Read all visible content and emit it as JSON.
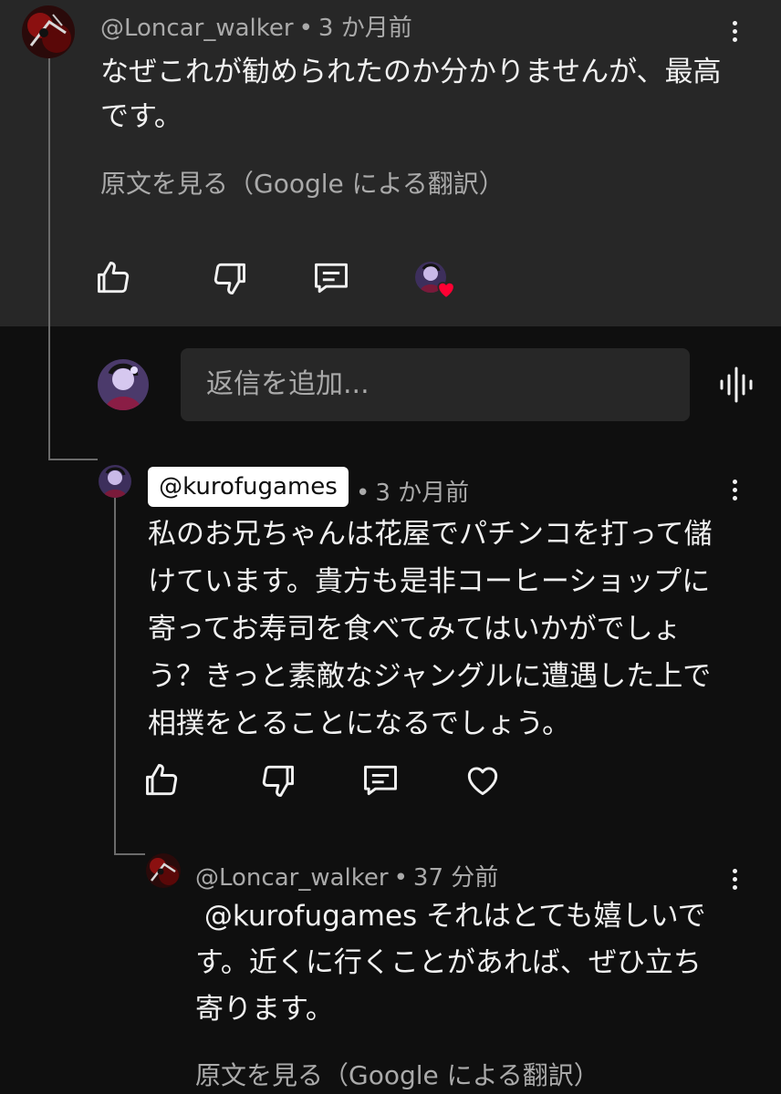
{
  "comment": {
    "author": "@Loncar_walker",
    "time": "3 か月前",
    "text": "なぜこれが勧められたのか分かりませんが、最高です。",
    "translate": "原文を見る（Google による翻訳）",
    "creator_heart": "hearted by creator"
  },
  "reply_box": {
    "placeholder": "返信を追加..."
  },
  "reply1": {
    "author": "@kurofugames",
    "time": "3 か月前",
    "text": "私のお兄ちゃんは花屋でパチンコを打って儲けています。貴方も是非コーヒーショップに寄ってお寿司を食べてみてはいかがでしょう？きっと素敵なジャングルに遭遇した上で相撲をとることになるでしょう。"
  },
  "reply2": {
    "author": "@Loncar_walker",
    "time": "37 分前",
    "text": " @kurofugames それはとても嬉しいです。近くに行くことがあれば、ぜひ立ち寄ります。",
    "translate": "原文を見る（Google による翻訳）"
  },
  "icons": {
    "like": "thumb-up-icon",
    "dislike": "thumb-down-icon",
    "reply": "comment-icon",
    "heart": "heart-icon",
    "more": "more-vert-icon",
    "voice": "voice-search-icon"
  },
  "colors": {
    "top_bg": "#272727",
    "page_bg": "#0f0f0f",
    "heart": "#ff0033",
    "text": "#f1f1f1",
    "secondary": "#aaaaaa"
  },
  "separator": "•"
}
